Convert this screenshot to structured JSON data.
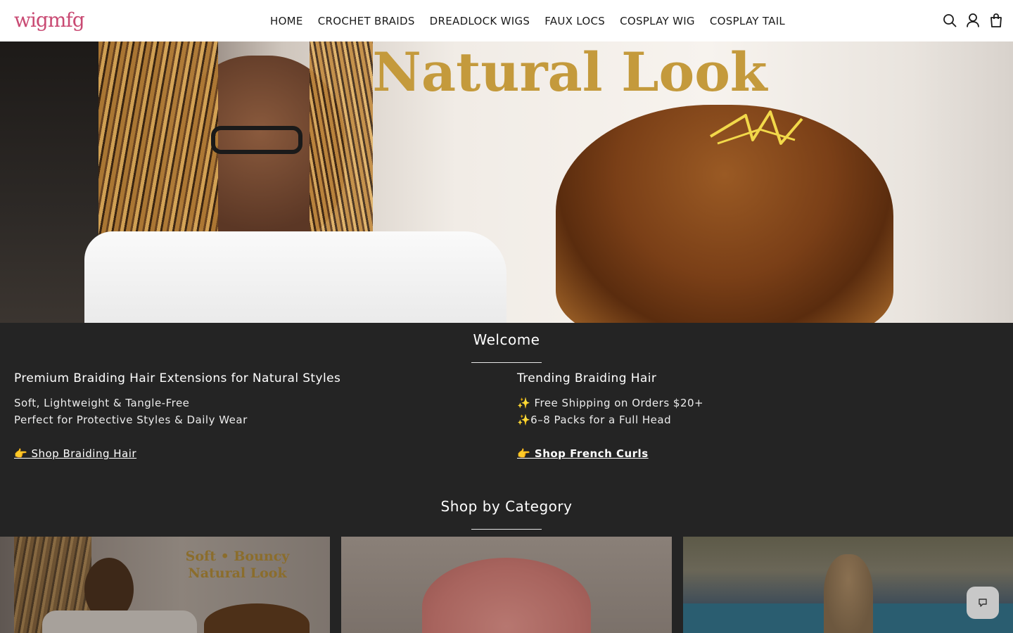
{
  "header": {
    "logo": "wigmfg",
    "nav": [
      "HOME",
      "CROCHET BRAIDS",
      "DREADLOCK WIGS",
      "FAUX LOCS",
      "COSPLAY WIG",
      "COSPLAY TAIL"
    ],
    "icons": [
      "search-icon",
      "account-icon",
      "cart-icon"
    ]
  },
  "hero": {
    "title": "Natural Look"
  },
  "welcome": {
    "title": "Welcome",
    "left": {
      "title": "Premium Braiding Hair Extensions for Natural Styles",
      "lines": [
        "Soft, Lightweight & Tangle-Free",
        "Perfect for Protective Styles & Daily Wear"
      ],
      "link": "👉 Shop Braiding Hair"
    },
    "right": {
      "title": "Trending Braiding Hair",
      "lines": [
        "✨ Free Shipping on Orders $20+",
        "✨6–8 Packs for a Full Head"
      ],
      "link": "👉 Shop French Curls"
    }
  },
  "categories": {
    "title": "Shop by Category",
    "cards": [
      {
        "text": "Soft • Bouncy\nNatural Look"
      },
      {
        "text": ""
      },
      {
        "text": ""
      }
    ]
  },
  "colors": {
    "brand": "#c94a73",
    "background": "#242424",
    "hero_title": "#c49a3c"
  }
}
